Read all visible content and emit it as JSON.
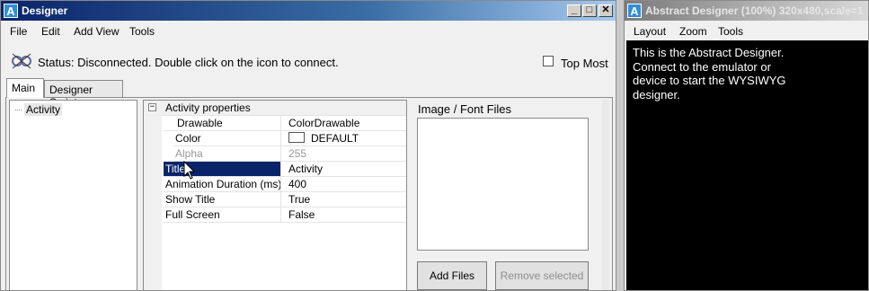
{
  "designer": {
    "title": "Designer",
    "controls": {
      "minimize": "_",
      "maximize": "□",
      "close": "✕"
    },
    "menu": [
      "File",
      "Edit",
      "Add View",
      "Tools"
    ],
    "status": "Status: Disconnected. Double click on the icon to connect.",
    "top_most": {
      "label": "Top Most",
      "checked": false
    },
    "tabs": [
      "Main",
      "Designer Scripts"
    ],
    "tree": [
      "Activity"
    ],
    "properties": {
      "category": "Activity properties",
      "rows": [
        {
          "name": "Drawable",
          "value": "ColorDrawable"
        },
        {
          "name": "Color",
          "value": "DEFAULT"
        },
        {
          "name": "Alpha",
          "value": "255"
        },
        {
          "name": "Title",
          "value": "Activity"
        },
        {
          "name": "Animation Duration (ms)",
          "value": "400"
        },
        {
          "name": "Show Title",
          "value": "True"
        },
        {
          "name": "Full Screen",
          "value": "False"
        }
      ]
    },
    "files": {
      "label": "Image / Font Files",
      "add_button": "Add Files",
      "remove_button": "Remove selected"
    }
  },
  "abstract": {
    "title": "Abstract Designer (100%) 320x480,scale=1",
    "menu": [
      "Layout",
      "Zoom",
      "Tools"
    ],
    "message": "This is the Abstract Designer.\nConnect to the emulator or\ndevice to start the WYSIWYG\ndesigner."
  },
  "icons": {
    "app": "app-logo-icon",
    "status": "connection-status-icon"
  },
  "colors": {
    "selection": "#0a246a",
    "titlebar_active": "#0a246a",
    "screen_background": "#000000"
  }
}
